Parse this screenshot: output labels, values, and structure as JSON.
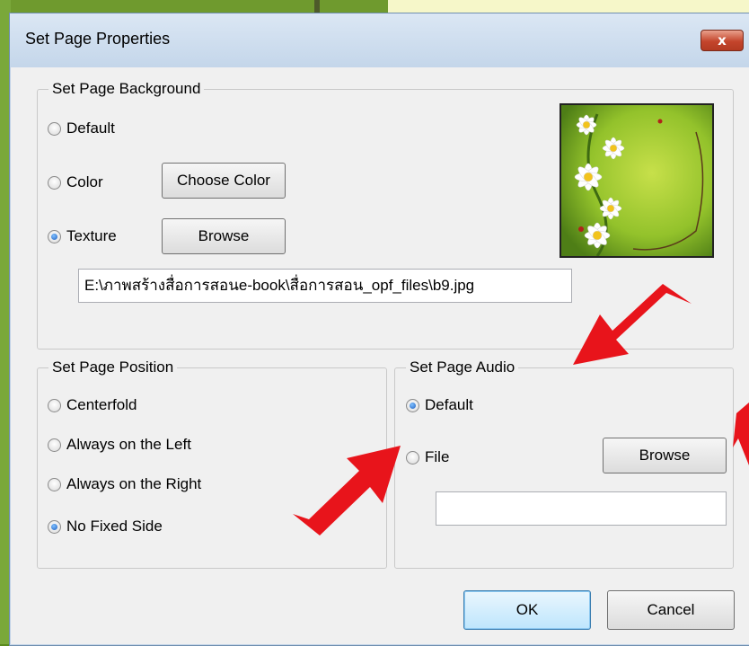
{
  "dialog": {
    "title": "Set Page Properties",
    "close_label": "x"
  },
  "background": {
    "group_label": "Set Page Background",
    "options": [
      {
        "label": "Default",
        "checked": false
      },
      {
        "label": "Color",
        "checked": false
      },
      {
        "label": "Texture",
        "checked": true
      }
    ],
    "choose_color_label": "Choose Color",
    "browse_label": "Browse",
    "texture_path": "E:\\ภาพสร้างสื่อการสอนe-book\\สื่อการสอน_opf_files\\b9.jpg"
  },
  "position": {
    "group_label": "Set Page Position",
    "options": [
      {
        "label": "Centerfold",
        "checked": false
      },
      {
        "label": "Always on the Left",
        "checked": false
      },
      {
        "label": "Always on the Right",
        "checked": false
      },
      {
        "label": "No Fixed Side",
        "checked": true
      }
    ]
  },
  "audio": {
    "group_label": "Set Page Audio",
    "options": [
      {
        "label": "Default",
        "checked": true
      },
      {
        "label": "File",
        "checked": false
      }
    ],
    "browse_label": "Browse",
    "file_path": ""
  },
  "footer": {
    "ok_label": "OK",
    "cancel_label": "Cancel"
  },
  "colors": {
    "annotation_arrow": "#e8141b",
    "texture_green": "#8cbf2a"
  }
}
